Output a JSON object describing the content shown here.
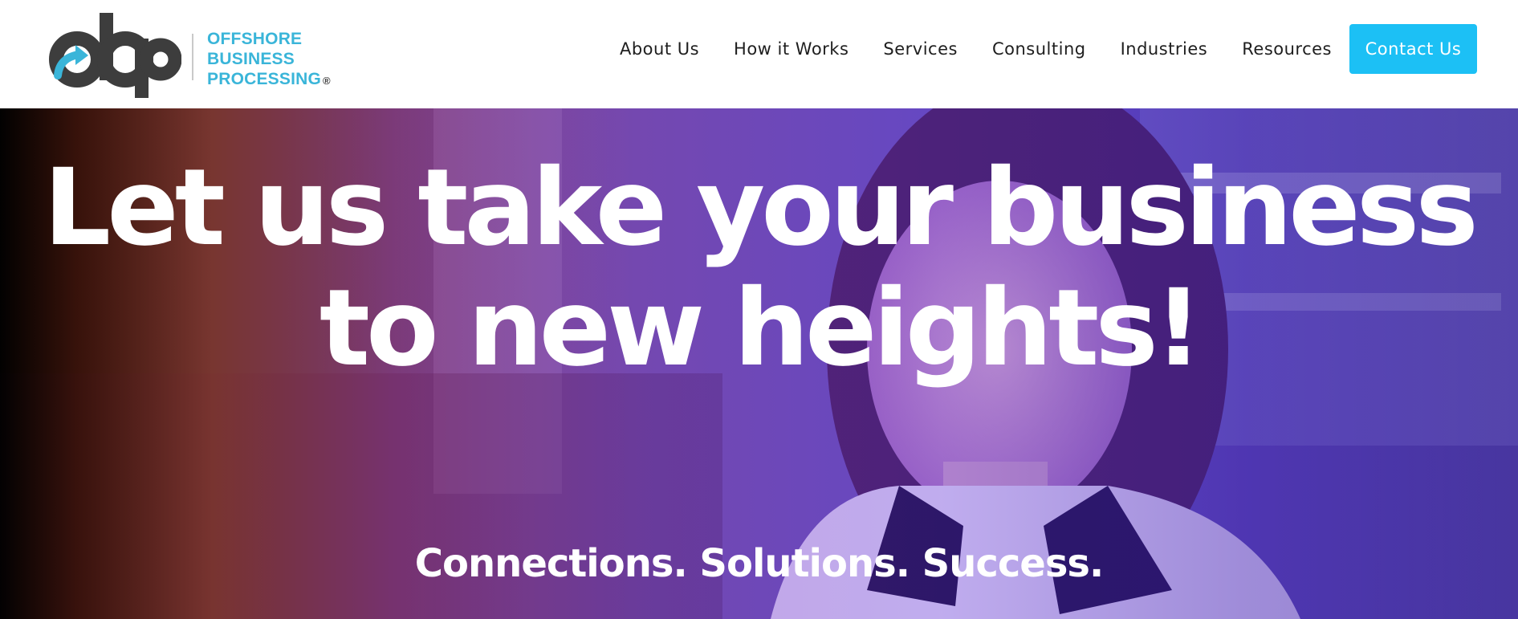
{
  "header": {
    "logo": {
      "mark_text": "obp",
      "lines": [
        "OFFSHORE",
        "BUSINESS",
        "PROCESSING"
      ],
      "registered_mark": "®"
    },
    "nav": [
      {
        "label": "About Us"
      },
      {
        "label": "How it Works"
      },
      {
        "label": "Services"
      },
      {
        "label": "Consulting"
      },
      {
        "label": "Industries"
      },
      {
        "label": "Resources"
      }
    ],
    "cta_label": "Contact Us"
  },
  "hero": {
    "title": "Let us take your business to new heights!",
    "tagline": "Connections. Solutions. Success."
  },
  "colors": {
    "brand_blue": "#3ab5d9",
    "cta_blue": "#1cc0f5",
    "logo_dark": "#3d3d3d",
    "hero_purple": "#6a3bd1"
  },
  "icons": {
    "logo_arrow": "arrow-up-right-icon"
  }
}
